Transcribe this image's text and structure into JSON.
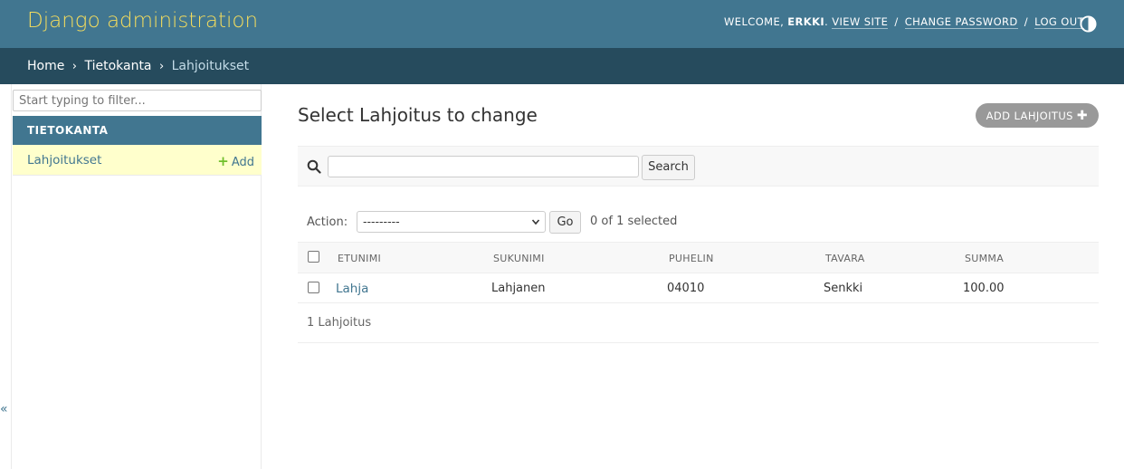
{
  "header": {
    "site_name": "Django administration",
    "welcome_prefix": "Welcome,",
    "username": "Erkki",
    "after_username": ".",
    "view_site": "View site",
    "change_password": "Change password",
    "log_out": "Log out",
    "separator": "/",
    "icon": "theme-toggle-icon"
  },
  "breadcrumbs": {
    "home": "Home",
    "app": "Tietokanta",
    "current": "Lahjoitukset",
    "arrow": "›"
  },
  "sidebar": {
    "filter_placeholder": "Start typing to filter...",
    "app_name": "Tietokanta",
    "model_name": "Lahjoitukset",
    "add_label": "Add",
    "add_icon": "plus-icon",
    "collapse_glyph": "«"
  },
  "content": {
    "title": "Select Lahjoitus to change",
    "add_button": "Add Lahjoitus",
    "search_button": "Search",
    "search_value": "",
    "action_label": "Action:",
    "action_selected": "---------",
    "go_button": "Go",
    "selection_counter": "0 of 1 selected",
    "columns": [
      "Etunimi",
      "Sukunimi",
      "Puhelin",
      "Tavara",
      "Summa"
    ],
    "rows": [
      {
        "etunimi": "Lahja",
        "sukunimi": "Lahjanen",
        "puhelin": "04010",
        "tavara": "Senkki",
        "summa": "100.00"
      }
    ],
    "paginator": "1 Lahjoitus"
  },
  "colors": {
    "header_bg": "#417690",
    "breadcrumb_bg": "#264b5d",
    "brand_text": "#f5dd5d",
    "link": "#417690",
    "selected_row_bg": "#ffffcc",
    "add_green": "#70bf2b"
  }
}
